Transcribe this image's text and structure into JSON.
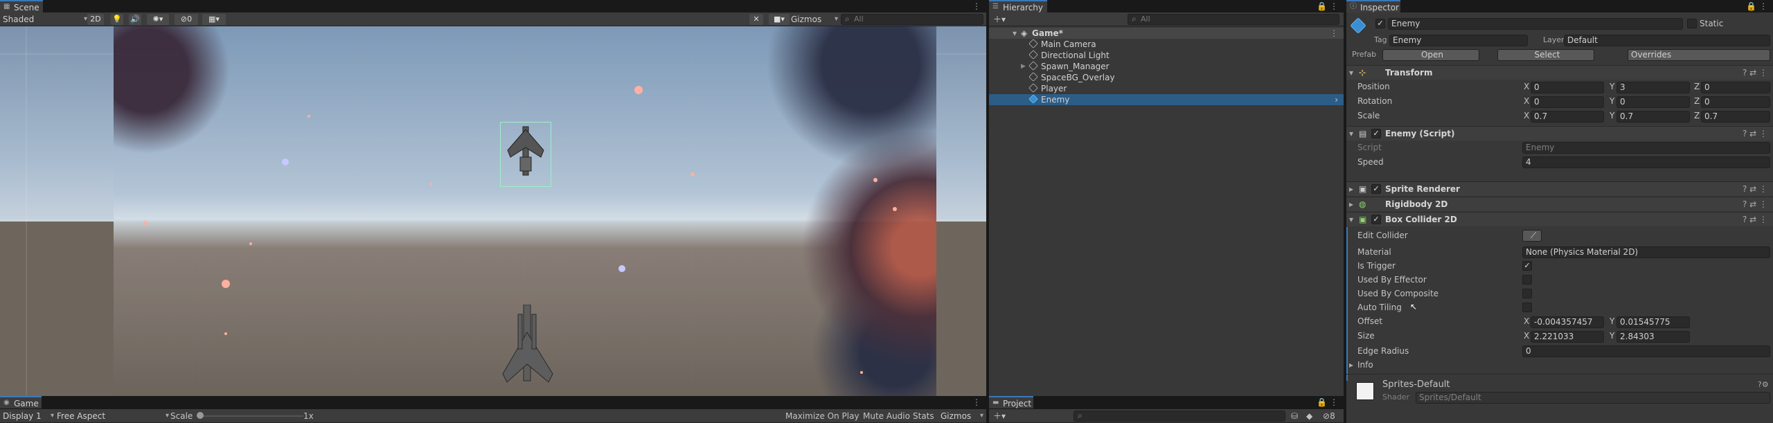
{
  "scene": {
    "tab": "Scene",
    "shading": "Shaded",
    "mode_2d": "2D",
    "gizmos": "Gizmos",
    "search_placeholder": "All",
    "hidden_count": "0"
  },
  "game": {
    "tab": "Game",
    "display": "Display 1",
    "aspect": "Free Aspect",
    "scale_label": "Scale",
    "scale_value": "1x",
    "maximize": "Maximize On Play",
    "mute": "Mute Audio",
    "stats": "Stats",
    "gizmos": "Gizmos"
  },
  "hierarchy": {
    "tab": "Hierarchy",
    "search_placeholder": "All",
    "root": "Game*",
    "items": [
      "Main Camera",
      "Directional Light",
      "Spawn_Manager",
      "SpaceBG_Overlay",
      "Player",
      "Enemy"
    ]
  },
  "project": {
    "tab": "Project",
    "badge": "8"
  },
  "inspector": {
    "tab": "Inspector",
    "object_name": "Enemy",
    "static": "Static",
    "tag_label": "Tag",
    "tag": "Enemy",
    "layer_label": "Layer",
    "layer": "Default",
    "prefab_label": "Prefab",
    "open": "Open",
    "select": "Select",
    "overrides": "Overrides",
    "transform": {
      "title": "Transform",
      "position_label": "Position",
      "pos": {
        "x": "0",
        "y": "3",
        "z": "0"
      },
      "rotation_label": "Rotation",
      "rot": {
        "x": "0",
        "y": "0",
        "z": "0"
      },
      "scale_label": "Scale",
      "scale": {
        "x": "0.7",
        "y": "0.7",
        "z": "0.7"
      }
    },
    "enemy_script": {
      "title": "Enemy (Script)",
      "script_label": "Script",
      "script_value": "Enemy",
      "speed_label": "Speed",
      "speed_value": "4"
    },
    "sprite_renderer": "Sprite Renderer",
    "rigidbody": "Rigidbody 2D",
    "box_collider": {
      "title": "Box Collider 2D",
      "edit_label": "Edit Collider",
      "material_label": "Material",
      "material_value": "None (Physics Material 2D)",
      "is_trigger": "Is Trigger",
      "used_by_effector": "Used By Effector",
      "used_by_composite": "Used By Composite",
      "auto_tiling": "Auto Tiling",
      "offset_label": "Offset",
      "offset": {
        "x": "-0.004357457",
        "y": "0.01545775"
      },
      "size_label": "Size",
      "size": {
        "x": "2.221033",
        "y": "2.84303"
      },
      "edge_label": "Edge Radius",
      "edge_value": "0",
      "info": "Info"
    },
    "material": {
      "name": "Sprites-Default",
      "shader_label": "Shader",
      "shader_value": "Sprites/Default"
    }
  },
  "colors": {
    "accent": "#3a79bb",
    "panel": "#383838",
    "selection": "#2c5d87"
  }
}
